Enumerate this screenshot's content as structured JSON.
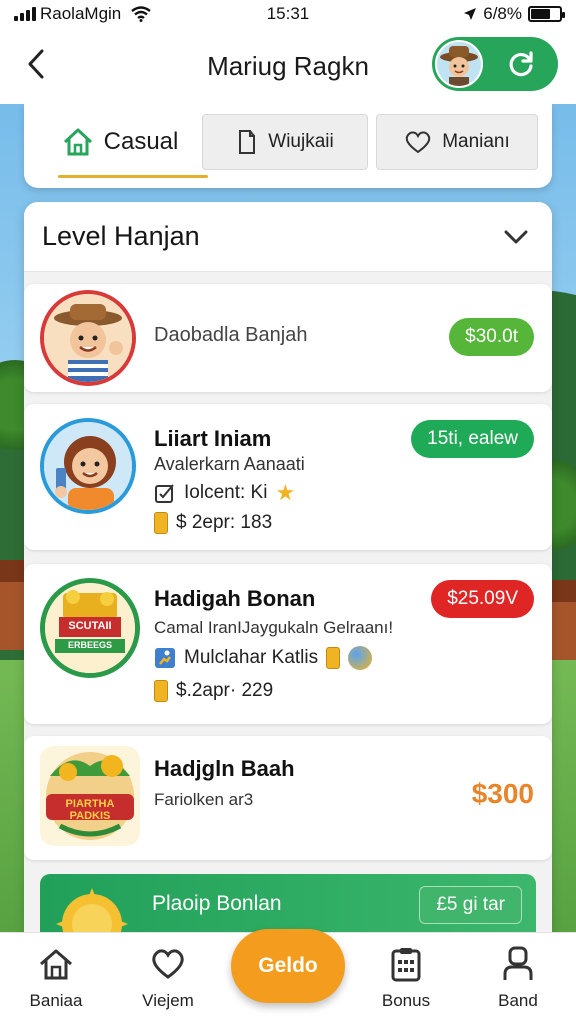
{
  "status_bar": {
    "carrier": "RaolaMgin",
    "time": "15:31",
    "battery": "6/8%",
    "battery_level": 0.68
  },
  "header": {
    "title": "Mariug Ragkn",
    "back_icon": "back-arrow-icon",
    "avatar_icon": "player-avatar",
    "refresh_icon": "refresh-icon"
  },
  "tabs": [
    {
      "label": "Casual",
      "icon": "home-icon",
      "active": true
    },
    {
      "label": "Wiujkaii",
      "icon": "card-icon",
      "active": false
    },
    {
      "label": "Manianı",
      "icon": "heart-icon",
      "active": false
    }
  ],
  "panel": {
    "title": "Level Hanjan"
  },
  "items": [
    {
      "name": "Daobadla Banjah",
      "badge": "$30.0t",
      "badge_color": "#55b63a"
    },
    {
      "name": "Liiart Iniam",
      "sub": "Avalerkarn Aanaati",
      "meta1": "Iolcent: Ki",
      "meta2": "$ 2epr: 183",
      "badge": "15ti, ealew",
      "badge_color": "#1faa58"
    },
    {
      "name": "Hadigah Bonan",
      "sub": "Camal IranIJaygukaln Gelraanı!",
      "meta1": "Mulclahar Katlis",
      "meta2": "$.2apr· 229",
      "logo_text_top": "SCUTAII",
      "logo_text_bottom": "ERBEEGS",
      "badge": "$25.09V",
      "badge_color": "#e02525"
    },
    {
      "name": "Hadjgln Baah",
      "sub": "Fariolken ar3",
      "logo_text": "PIARTHA PADKIS",
      "price": "$300",
      "price_color": "#e8852a"
    }
  ],
  "promo": {
    "name": "Plaoip Bonlan",
    "badge": "£5 gi tar"
  },
  "bottom_nav": [
    {
      "label": "Baniaa",
      "icon": "home-icon"
    },
    {
      "label": "Viejem",
      "icon": "heart-icon"
    },
    {
      "label": "Geldo",
      "icon": "action-button"
    },
    {
      "label": "Bonus",
      "icon": "list-icon"
    },
    {
      "label": "Band",
      "icon": "person-icon"
    }
  ],
  "colors": {
    "accent_green": "#27a55a",
    "accent_orange": "#f39c1d",
    "tab_underline": "#e2b02c"
  }
}
